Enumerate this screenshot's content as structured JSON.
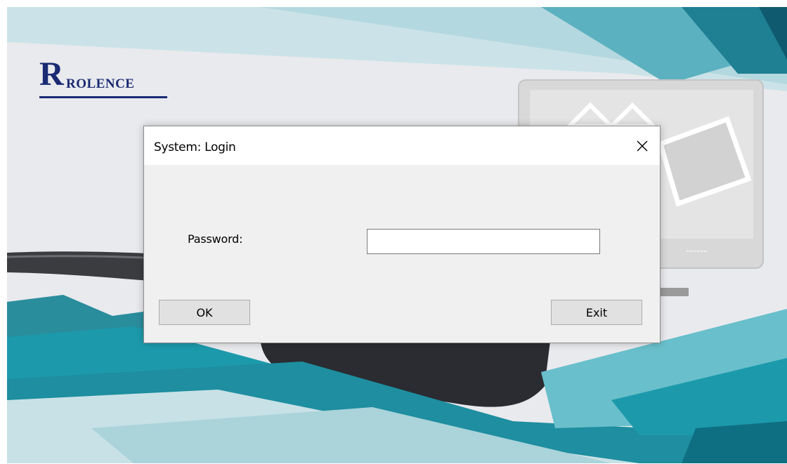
{
  "splash": {
    "logo_initial": "R",
    "logo_text": "ROLENCE",
    "monitor_dashes": "------"
  },
  "dialog": {
    "title": "System: Login",
    "close_icon": "close-icon",
    "password_label": "Password:",
    "password_value": "",
    "ok_label": "OK",
    "exit_label": "Exit"
  },
  "colors": {
    "brand_navy": "#1a2a73",
    "teal": "#1c9aac",
    "dialog_bg": "#f0f0f0"
  }
}
